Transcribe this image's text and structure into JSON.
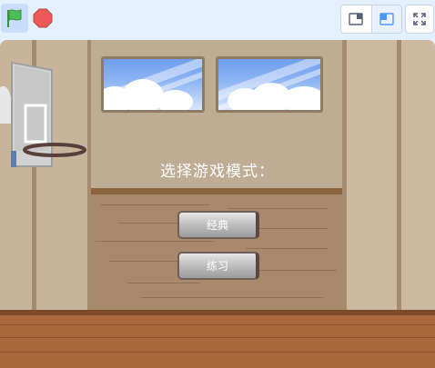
{
  "toolbar": {
    "flag_color": "#4cbf56",
    "stop_color": "#ec5959"
  },
  "stage": {
    "prompt": "选择游戏模式：",
    "buttons": [
      {
        "label": "经典"
      },
      {
        "label": "练习"
      }
    ]
  }
}
